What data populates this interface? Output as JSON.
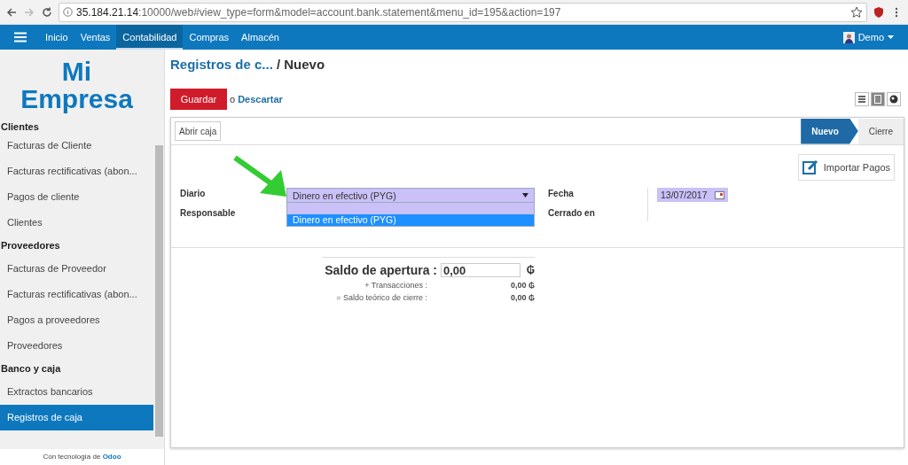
{
  "browser": {
    "url_host": "35.184.21.14",
    "url_rest": ":10000/web#view_type=form&model=account.bank.statement&menu_id=195&action=197"
  },
  "nav": {
    "items": [
      {
        "label": "Inicio",
        "selected": false
      },
      {
        "label": "Ventas",
        "selected": false
      },
      {
        "label": "Contabilidad",
        "selected": true
      },
      {
        "label": "Compras",
        "selected": false
      },
      {
        "label": "Almacén",
        "selected": false
      }
    ],
    "user": "Demo"
  },
  "sidebar": {
    "logo_lines": [
      "Mi",
      "Empresa"
    ],
    "sections": [
      {
        "title": "Clientes",
        "items": [
          {
            "label": "Facturas de Cliente",
            "selected": false
          },
          {
            "label": "Facturas rectificativas (abon...",
            "selected": false
          },
          {
            "label": "Pagos de cliente",
            "selected": false
          },
          {
            "label": "Clientes",
            "selected": false
          }
        ]
      },
      {
        "title": "Proveedores",
        "items": [
          {
            "label": "Facturas de Proveedor",
            "selected": false
          },
          {
            "label": "Facturas rectificativas (abon...",
            "selected": false
          },
          {
            "label": "Pagos a proveedores",
            "selected": false
          },
          {
            "label": "Proveedores",
            "selected": false
          }
        ]
      },
      {
        "title": "Banco y caja",
        "items": [
          {
            "label": "Extractos bancarios",
            "selected": false
          },
          {
            "label": "Registros de caja",
            "selected": true
          }
        ]
      }
    ],
    "footer_text": "Con tecnología de",
    "footer_link": "Odoo"
  },
  "breadcrumb": {
    "parent": "Registros de c...",
    "current": "/ Nuevo"
  },
  "actions": {
    "save": "Guardar",
    "or": "o",
    "discard": "Descartar"
  },
  "views": [
    {
      "kind": "list",
      "selected": false
    },
    {
      "kind": "form",
      "selected": true
    },
    {
      "kind": "map",
      "selected": false
    }
  ],
  "form": {
    "header_button": "Abrir caja",
    "stages": [
      {
        "label": "Nuevo",
        "selected": true
      },
      {
        "label": "Cierre",
        "selected": false
      }
    ],
    "import_button": "Importar Pagos",
    "diario": {
      "label": "Diario",
      "value": "Dinero en efectivo (PYG)",
      "options": [
        {
          "label": "Dinero en efectivo (PYG)",
          "selected": true
        }
      ]
    },
    "responsable": {
      "label": "Responsable"
    },
    "fecha": {
      "label": "Fecha",
      "value": "13/07/2017"
    },
    "cerrado": {
      "label": "Cerrado en"
    },
    "opening": {
      "label": "Saldo de apertura :",
      "value": "0,00",
      "currency": "₲"
    },
    "totals": [
      {
        "label": "+ Transacciones :",
        "value": "0,00 ₲"
      },
      {
        "label": "= Saldo teórico de cierre :",
        "value": "0,00 ₲"
      }
    ]
  }
}
